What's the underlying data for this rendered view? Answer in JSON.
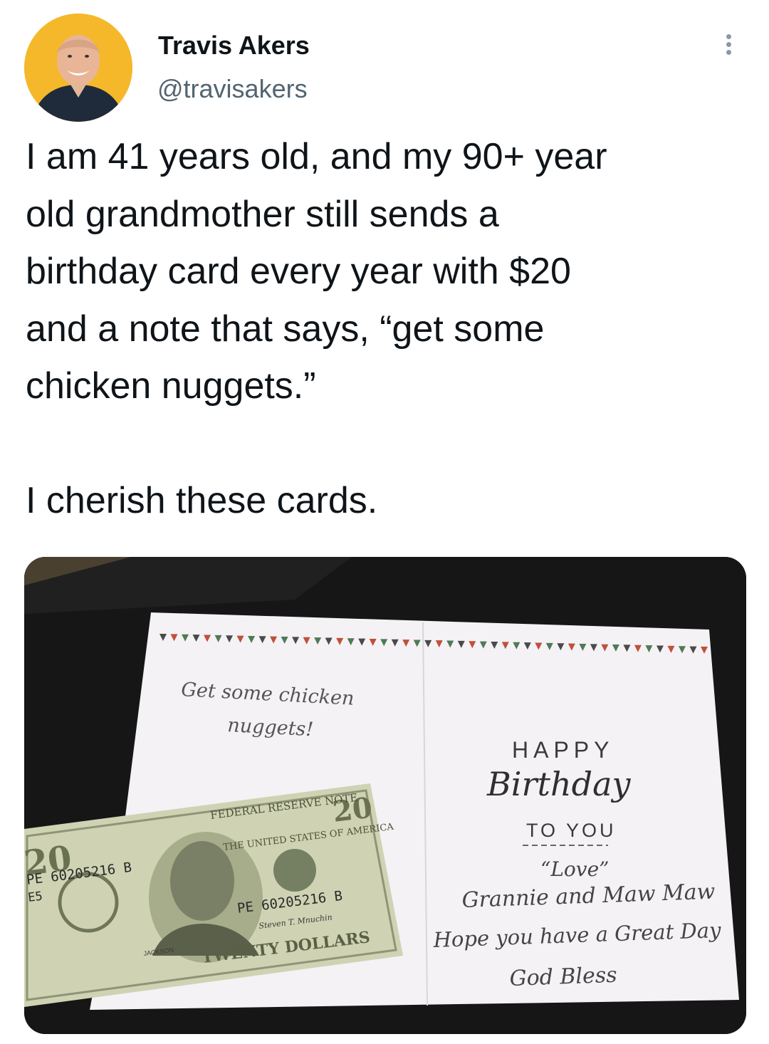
{
  "author": {
    "display_name": "Travis Akers",
    "handle": "@travisakers",
    "avatar_icon": "profile-photo"
  },
  "more_icon": "more-options-icon",
  "tweet": {
    "text": "I am 41 years old, and my 90+ year\nold grandmother still sends a\nbirthday card every year with $20\nand a note that says, “get some\nchicken nuggets.”\n\nI cherish these cards."
  },
  "media": {
    "alt": "",
    "card": {
      "note_line1": "Get some chicken",
      "note_line2": "nuggets!",
      "happy": "HAPPY",
      "birthday": "Birthday",
      "to_you": "TO YOU",
      "love": "“Love”",
      "signed": "Grannie and Maw Maw",
      "wish": "Hope you have a Great Day",
      "blessing": "God Bless"
    },
    "bill": {
      "denomination": "20",
      "serial": "PE 60205216 B",
      "bank": "E5",
      "header": "FEDERAL RESERVE NOTE",
      "country": "THE UNITED STATES OF AMERICA",
      "words": "TWENTY DOLLARS",
      "portrait_name": "JACKSON",
      "signature": "Steven T. Mnuchin"
    },
    "colors": {
      "background": "#1a1a1a",
      "card": "#f4f2f5",
      "bill": "#cfd3b3",
      "bunting_red": "#c0503a",
      "bunting_green": "#4f7a55",
      "bunting_grey": "#4a4a4a"
    }
  }
}
